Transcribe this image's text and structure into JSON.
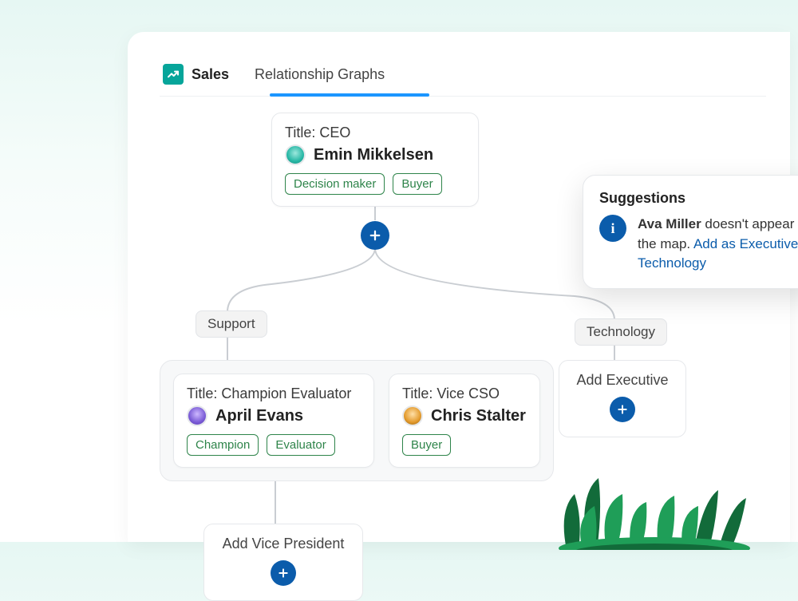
{
  "tabs": {
    "sales": "Sales",
    "relationship": "Relationship Graphs"
  },
  "ceo_node": {
    "title": "Title: CEO",
    "name": "Emin Mikkelsen",
    "chips": [
      "Decision maker",
      "Buyer"
    ]
  },
  "groups": {
    "support": "Support",
    "technology": "Technology"
  },
  "support_nodes": {
    "a": {
      "title": "Title: Champion Evaluator",
      "name": "April Evans",
      "chips": [
        "Champion",
        "Evaluator"
      ]
    },
    "b": {
      "title": "Title: Vice CSO",
      "name": "Chris Stalter",
      "chips": [
        "Buyer"
      ]
    }
  },
  "add_cards": {
    "executive": "Add Executive",
    "vp": "Add Vice President"
  },
  "suggestions": {
    "heading": "Suggestions",
    "bold_name": "Ava Miller",
    "text_after_name": " doesn't appear on the map. ",
    "link": "Add as Executive in Technology"
  }
}
